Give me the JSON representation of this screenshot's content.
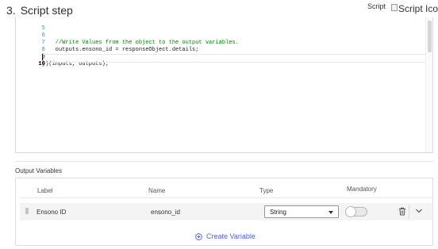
{
  "header": {
    "step_number": "3.",
    "title": "Script step",
    "script_label": "Script",
    "script_icon_alt": "Script Icon"
  },
  "editor": {
    "lines": [
      {
        "number": "5",
        "text": ""
      },
      {
        "number": "6",
        "text": "    //Write Values from the object to the output variables."
      },
      {
        "number": "7",
        "text": "    outputs.ensono_id = responseObject.details;"
      },
      {
        "number": "8",
        "text": "}"
      },
      {
        "number": "9",
        "text": "})(inputs, outputs);"
      },
      {
        "number": "10",
        "text": ""
      }
    ],
    "active_line": "10"
  },
  "outputs": {
    "section_label": "Output Variables",
    "columns": {
      "label": "Label",
      "name": "Name",
      "type": "Type",
      "mandatory": "Mandatory"
    },
    "rows": [
      {
        "label": "Ensono ID",
        "name": "ensono_id",
        "type": "String",
        "mandatory": false
      }
    ],
    "create_label": "Create Variable"
  },
  "colors": {
    "accent": "#4a63c9",
    "comment": "#008000",
    "line_number": "#2b91af"
  }
}
